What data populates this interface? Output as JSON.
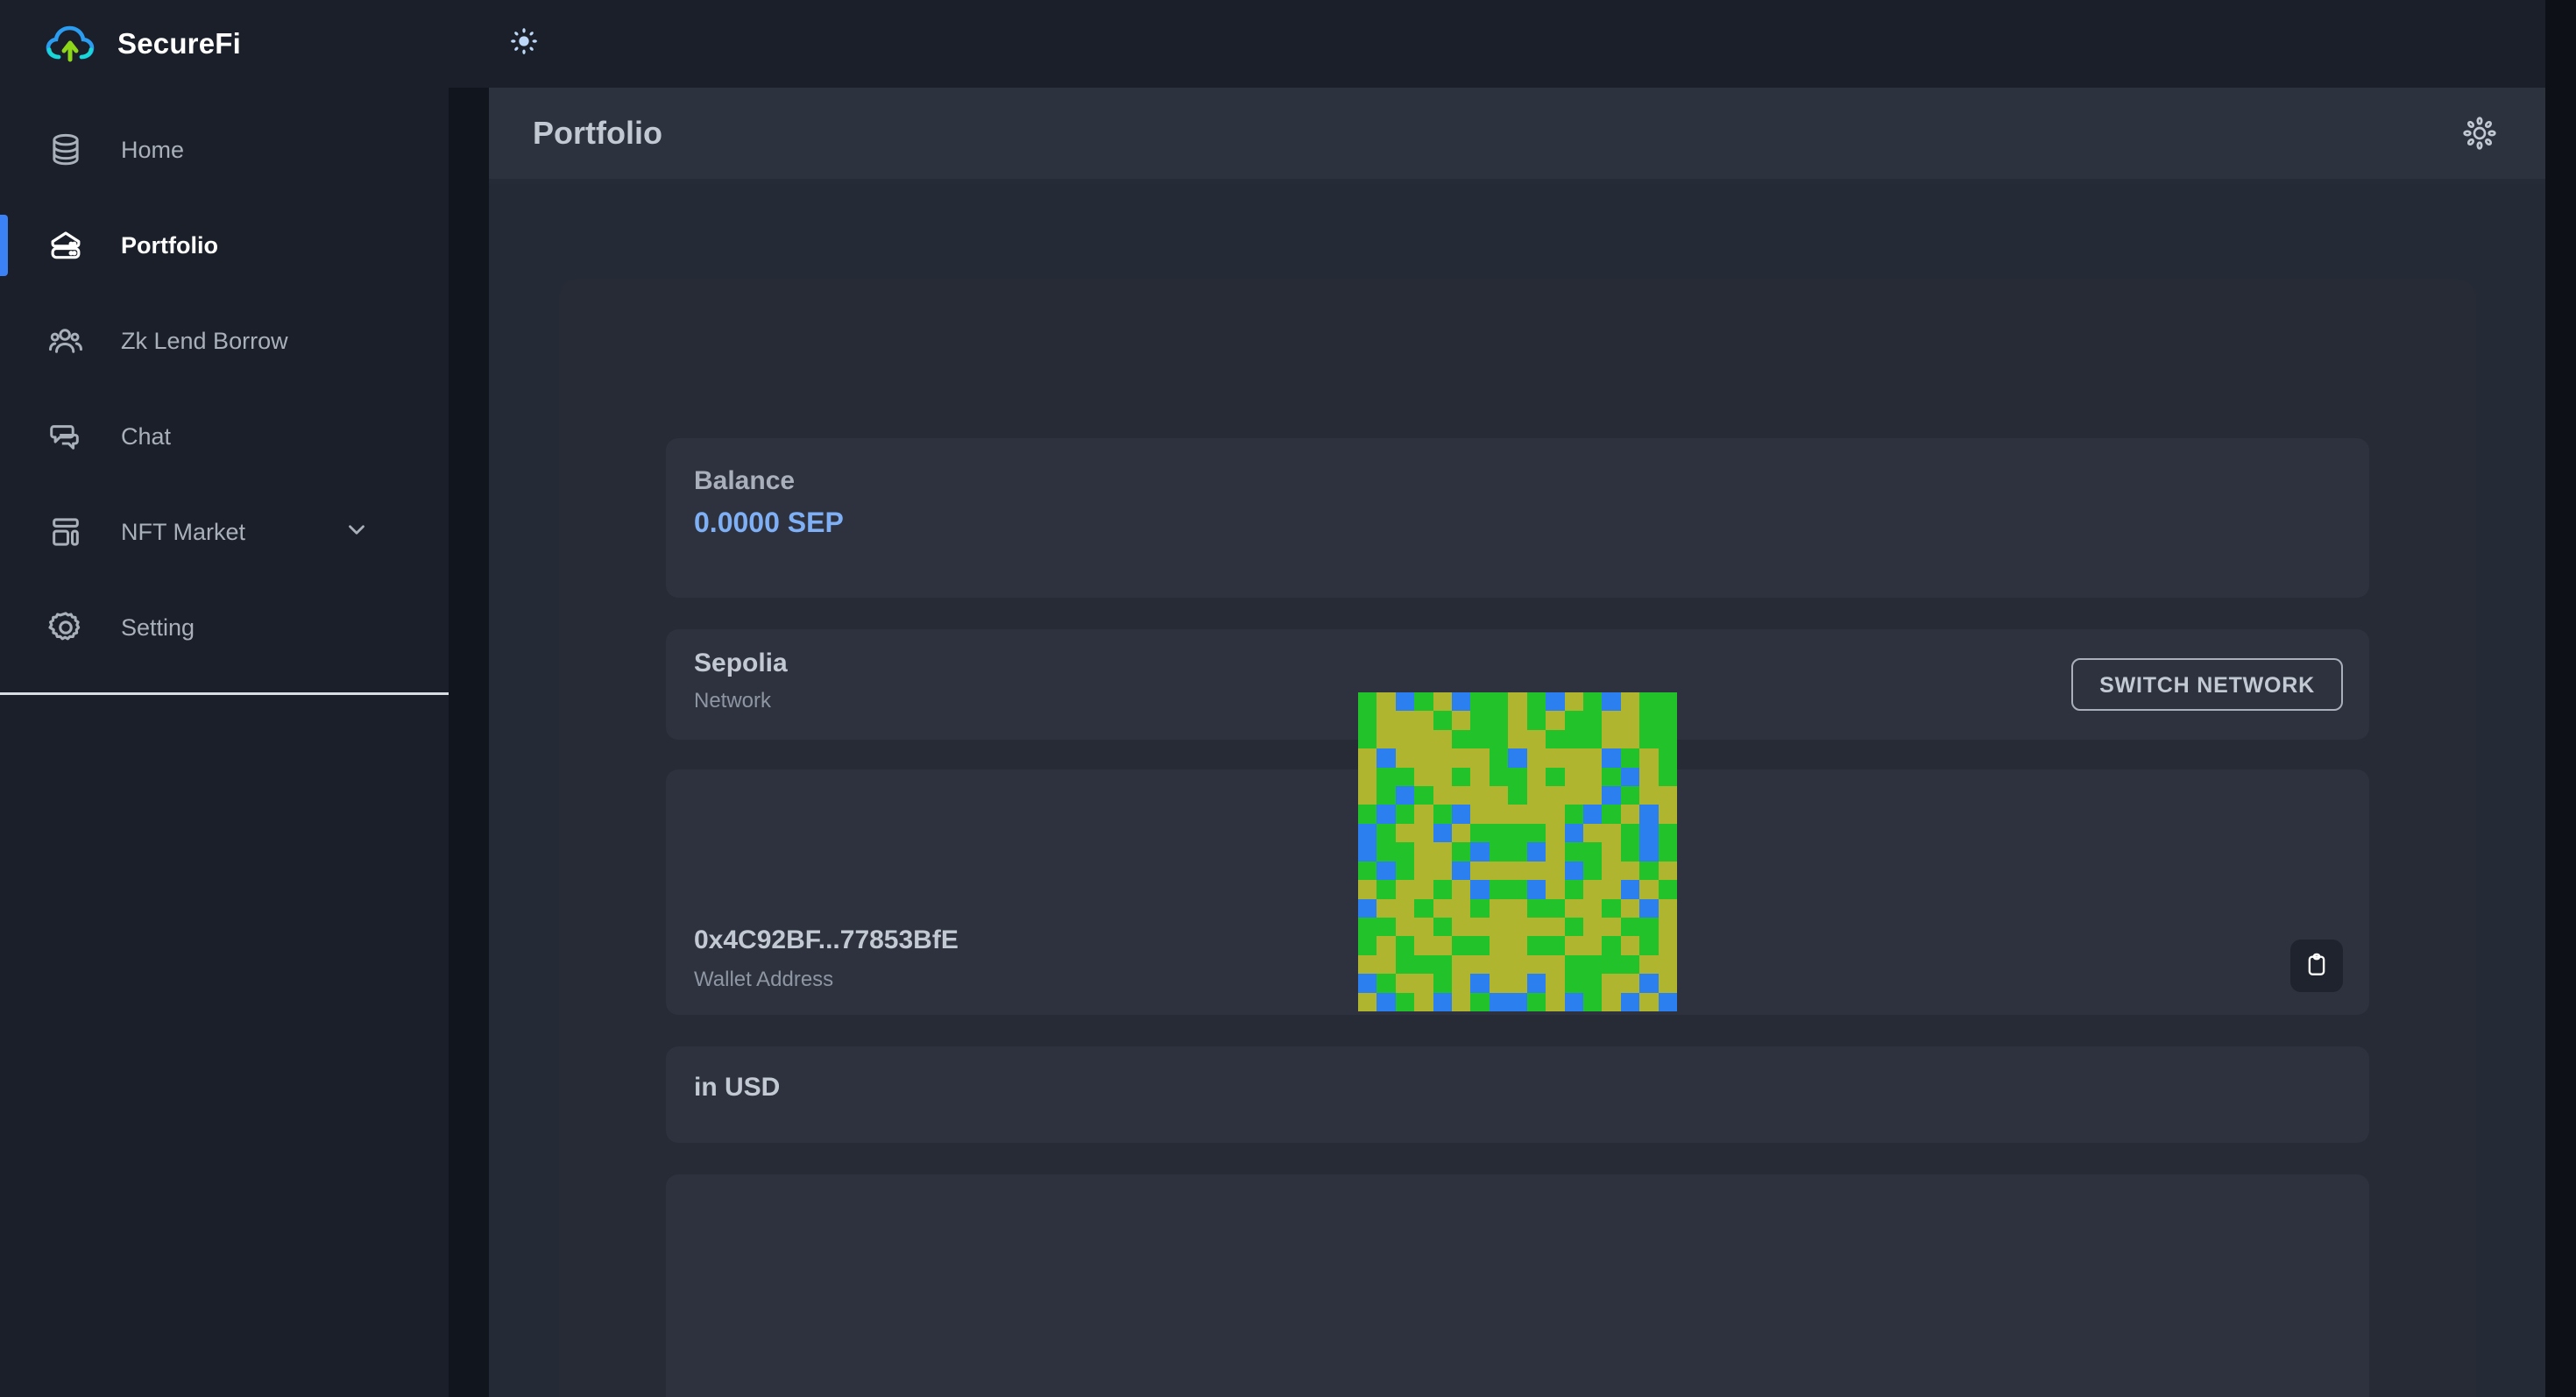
{
  "brand": {
    "name": "SecureFi",
    "logo_icon": "cloud-upload-icon"
  },
  "sidebar": {
    "items": [
      {
        "label": "Home",
        "icon": "database-icon",
        "active": false,
        "expandable": false
      },
      {
        "label": "Portfolio",
        "icon": "server-stack-icon",
        "active": true,
        "expandable": false
      },
      {
        "label": "Zk Lend Borrow",
        "icon": "users-group-icon",
        "active": false,
        "expandable": false
      },
      {
        "label": "Chat",
        "icon": "chat-bubbles-icon",
        "active": false,
        "expandable": false
      },
      {
        "label": "NFT Market",
        "icon": "dashboard-layout-icon",
        "active": false,
        "expandable": true
      },
      {
        "label": "Setting",
        "icon": "gear-icon",
        "active": false,
        "expandable": false
      }
    ]
  },
  "topbar": {
    "theme_toggle_icon": "sun-icon"
  },
  "header": {
    "title": "Portfolio",
    "settings_icon": "sun-brightness-icon"
  },
  "main": {
    "balance_card": {
      "label": "Balance",
      "value": "0.0000 SEP"
    },
    "network_card": {
      "name": "Sepolia",
      "sublabel": "Network",
      "switch_button": "SWITCH NETWORK"
    },
    "wallet_card": {
      "address": "0x4C92BF...77853BfE",
      "sublabel": "Wallet Address",
      "copy_icon": "clipboard-icon",
      "identicon": {
        "name": "wallet-identicon",
        "colors": {
          "green": "#22c32a",
          "olive": "#afb52e",
          "blue": "#2c7fee"
        },
        "grid": [
          "gobgobggogbogbog",
          "gooogoggogoggoog",
          "goooogggoogggoog",
          "obooooogboooobgo",
          "oggoogoggogoogbo",
          "ogbgoooogoooobgo",
          "gbgogbooooogbgob",
          "bgooboggggoboogb",
          "bggoogbggboggogb",
          "gbgoobooooobgoog",
          "ogoogobggbogoobo",
          "boogoogooggoogob",
          "ggoogoooooogoogg",
          "gogooggooggoogog",
          "oogggooooooggggo",
          "bgoogobooboggoob",
          "obgobogbbgobgobo"
        ]
      }
    },
    "usd_card": {
      "title": "in USD"
    }
  },
  "colors": {
    "accent_blue": "#3b82f6",
    "balance_blue": "#7fb0f5",
    "sidebar_bg": "#1a1f29",
    "content_bg": "#252b36",
    "card_bg": "#2d323e"
  }
}
